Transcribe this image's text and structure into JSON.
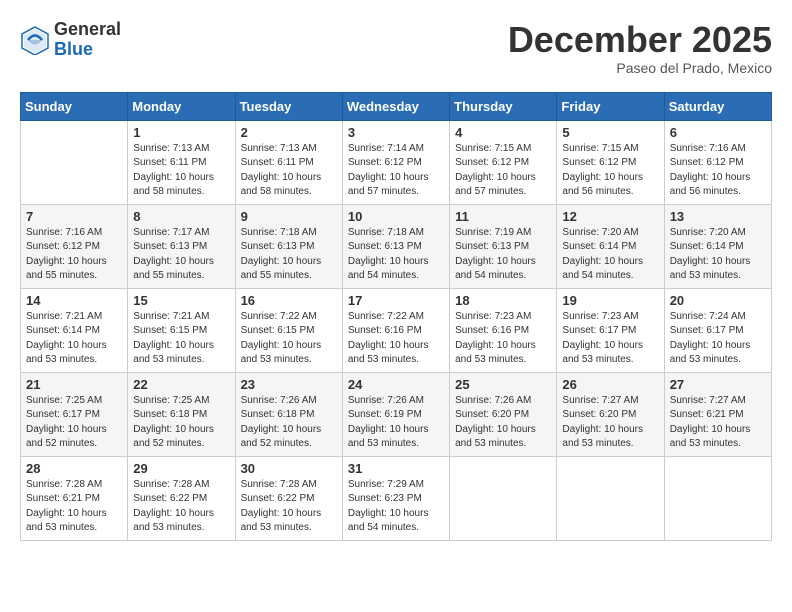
{
  "header": {
    "logo_general": "General",
    "logo_blue": "Blue",
    "month_title": "December 2025",
    "location": "Paseo del Prado, Mexico"
  },
  "weekdays": [
    "Sunday",
    "Monday",
    "Tuesday",
    "Wednesday",
    "Thursday",
    "Friday",
    "Saturday"
  ],
  "weeks": [
    [
      {
        "day": "",
        "sunrise": "",
        "sunset": "",
        "daylight": ""
      },
      {
        "day": "1",
        "sunrise": "Sunrise: 7:13 AM",
        "sunset": "Sunset: 6:11 PM",
        "daylight": "Daylight: 10 hours and 58 minutes."
      },
      {
        "day": "2",
        "sunrise": "Sunrise: 7:13 AM",
        "sunset": "Sunset: 6:11 PM",
        "daylight": "Daylight: 10 hours and 58 minutes."
      },
      {
        "day": "3",
        "sunrise": "Sunrise: 7:14 AM",
        "sunset": "Sunset: 6:12 PM",
        "daylight": "Daylight: 10 hours and 57 minutes."
      },
      {
        "day": "4",
        "sunrise": "Sunrise: 7:15 AM",
        "sunset": "Sunset: 6:12 PM",
        "daylight": "Daylight: 10 hours and 57 minutes."
      },
      {
        "day": "5",
        "sunrise": "Sunrise: 7:15 AM",
        "sunset": "Sunset: 6:12 PM",
        "daylight": "Daylight: 10 hours and 56 minutes."
      },
      {
        "day": "6",
        "sunrise": "Sunrise: 7:16 AM",
        "sunset": "Sunset: 6:12 PM",
        "daylight": "Daylight: 10 hours and 56 minutes."
      }
    ],
    [
      {
        "day": "7",
        "sunrise": "Sunrise: 7:16 AM",
        "sunset": "Sunset: 6:12 PM",
        "daylight": "Daylight: 10 hours and 55 minutes."
      },
      {
        "day": "8",
        "sunrise": "Sunrise: 7:17 AM",
        "sunset": "Sunset: 6:13 PM",
        "daylight": "Daylight: 10 hours and 55 minutes."
      },
      {
        "day": "9",
        "sunrise": "Sunrise: 7:18 AM",
        "sunset": "Sunset: 6:13 PM",
        "daylight": "Daylight: 10 hours and 55 minutes."
      },
      {
        "day": "10",
        "sunrise": "Sunrise: 7:18 AM",
        "sunset": "Sunset: 6:13 PM",
        "daylight": "Daylight: 10 hours and 54 minutes."
      },
      {
        "day": "11",
        "sunrise": "Sunrise: 7:19 AM",
        "sunset": "Sunset: 6:13 PM",
        "daylight": "Daylight: 10 hours and 54 minutes."
      },
      {
        "day": "12",
        "sunrise": "Sunrise: 7:20 AM",
        "sunset": "Sunset: 6:14 PM",
        "daylight": "Daylight: 10 hours and 54 minutes."
      },
      {
        "day": "13",
        "sunrise": "Sunrise: 7:20 AM",
        "sunset": "Sunset: 6:14 PM",
        "daylight": "Daylight: 10 hours and 53 minutes."
      }
    ],
    [
      {
        "day": "14",
        "sunrise": "Sunrise: 7:21 AM",
        "sunset": "Sunset: 6:14 PM",
        "daylight": "Daylight: 10 hours and 53 minutes."
      },
      {
        "day": "15",
        "sunrise": "Sunrise: 7:21 AM",
        "sunset": "Sunset: 6:15 PM",
        "daylight": "Daylight: 10 hours and 53 minutes."
      },
      {
        "day": "16",
        "sunrise": "Sunrise: 7:22 AM",
        "sunset": "Sunset: 6:15 PM",
        "daylight": "Daylight: 10 hours and 53 minutes."
      },
      {
        "day": "17",
        "sunrise": "Sunrise: 7:22 AM",
        "sunset": "Sunset: 6:16 PM",
        "daylight": "Daylight: 10 hours and 53 minutes."
      },
      {
        "day": "18",
        "sunrise": "Sunrise: 7:23 AM",
        "sunset": "Sunset: 6:16 PM",
        "daylight": "Daylight: 10 hours and 53 minutes."
      },
      {
        "day": "19",
        "sunrise": "Sunrise: 7:23 AM",
        "sunset": "Sunset: 6:17 PM",
        "daylight": "Daylight: 10 hours and 53 minutes."
      },
      {
        "day": "20",
        "sunrise": "Sunrise: 7:24 AM",
        "sunset": "Sunset: 6:17 PM",
        "daylight": "Daylight: 10 hours and 53 minutes."
      }
    ],
    [
      {
        "day": "21",
        "sunrise": "Sunrise: 7:25 AM",
        "sunset": "Sunset: 6:17 PM",
        "daylight": "Daylight: 10 hours and 52 minutes."
      },
      {
        "day": "22",
        "sunrise": "Sunrise: 7:25 AM",
        "sunset": "Sunset: 6:18 PM",
        "daylight": "Daylight: 10 hours and 52 minutes."
      },
      {
        "day": "23",
        "sunrise": "Sunrise: 7:26 AM",
        "sunset": "Sunset: 6:18 PM",
        "daylight": "Daylight: 10 hours and 52 minutes."
      },
      {
        "day": "24",
        "sunrise": "Sunrise: 7:26 AM",
        "sunset": "Sunset: 6:19 PM",
        "daylight": "Daylight: 10 hours and 53 minutes."
      },
      {
        "day": "25",
        "sunrise": "Sunrise: 7:26 AM",
        "sunset": "Sunset: 6:20 PM",
        "daylight": "Daylight: 10 hours and 53 minutes."
      },
      {
        "day": "26",
        "sunrise": "Sunrise: 7:27 AM",
        "sunset": "Sunset: 6:20 PM",
        "daylight": "Daylight: 10 hours and 53 minutes."
      },
      {
        "day": "27",
        "sunrise": "Sunrise: 7:27 AM",
        "sunset": "Sunset: 6:21 PM",
        "daylight": "Daylight: 10 hours and 53 minutes."
      }
    ],
    [
      {
        "day": "28",
        "sunrise": "Sunrise: 7:28 AM",
        "sunset": "Sunset: 6:21 PM",
        "daylight": "Daylight: 10 hours and 53 minutes."
      },
      {
        "day": "29",
        "sunrise": "Sunrise: 7:28 AM",
        "sunset": "Sunset: 6:22 PM",
        "daylight": "Daylight: 10 hours and 53 minutes."
      },
      {
        "day": "30",
        "sunrise": "Sunrise: 7:28 AM",
        "sunset": "Sunset: 6:22 PM",
        "daylight": "Daylight: 10 hours and 53 minutes."
      },
      {
        "day": "31",
        "sunrise": "Sunrise: 7:29 AM",
        "sunset": "Sunset: 6:23 PM",
        "daylight": "Daylight: 10 hours and 54 minutes."
      },
      {
        "day": "",
        "sunrise": "",
        "sunset": "",
        "daylight": ""
      },
      {
        "day": "",
        "sunrise": "",
        "sunset": "",
        "daylight": ""
      },
      {
        "day": "",
        "sunrise": "",
        "sunset": "",
        "daylight": ""
      }
    ]
  ]
}
